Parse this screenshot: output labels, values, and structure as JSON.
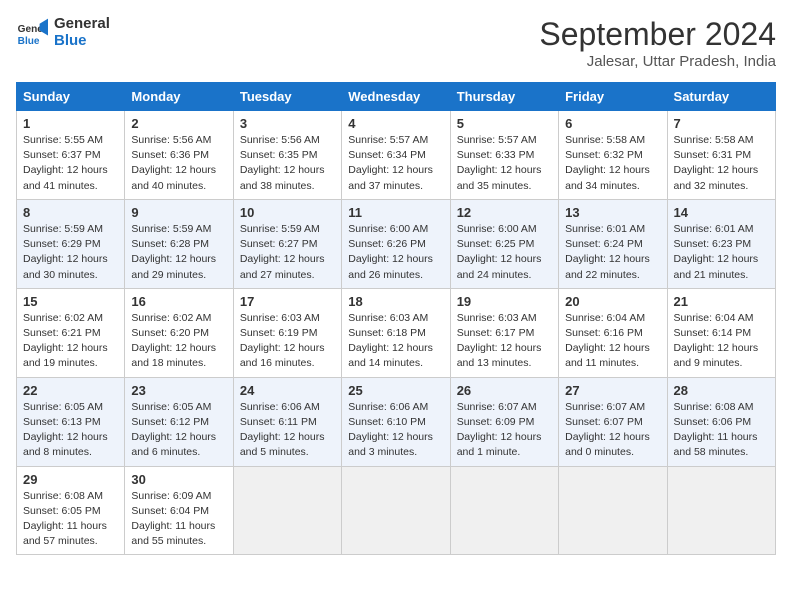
{
  "header": {
    "logo_line1": "General",
    "logo_line2": "Blue",
    "month": "September 2024",
    "location": "Jalesar, Uttar Pradesh, India"
  },
  "days_of_week": [
    "Sunday",
    "Monday",
    "Tuesday",
    "Wednesday",
    "Thursday",
    "Friday",
    "Saturday"
  ],
  "weeks": [
    [
      {
        "day": "1",
        "sunrise": "Sunrise: 5:55 AM",
        "sunset": "Sunset: 6:37 PM",
        "daylight": "Daylight: 12 hours and 41 minutes."
      },
      {
        "day": "2",
        "sunrise": "Sunrise: 5:56 AM",
        "sunset": "Sunset: 6:36 PM",
        "daylight": "Daylight: 12 hours and 40 minutes."
      },
      {
        "day": "3",
        "sunrise": "Sunrise: 5:56 AM",
        "sunset": "Sunset: 6:35 PM",
        "daylight": "Daylight: 12 hours and 38 minutes."
      },
      {
        "day": "4",
        "sunrise": "Sunrise: 5:57 AM",
        "sunset": "Sunset: 6:34 PM",
        "daylight": "Daylight: 12 hours and 37 minutes."
      },
      {
        "day": "5",
        "sunrise": "Sunrise: 5:57 AM",
        "sunset": "Sunset: 6:33 PM",
        "daylight": "Daylight: 12 hours and 35 minutes."
      },
      {
        "day": "6",
        "sunrise": "Sunrise: 5:58 AM",
        "sunset": "Sunset: 6:32 PM",
        "daylight": "Daylight: 12 hours and 34 minutes."
      },
      {
        "day": "7",
        "sunrise": "Sunrise: 5:58 AM",
        "sunset": "Sunset: 6:31 PM",
        "daylight": "Daylight: 12 hours and 32 minutes."
      }
    ],
    [
      {
        "day": "8",
        "sunrise": "Sunrise: 5:59 AM",
        "sunset": "Sunset: 6:29 PM",
        "daylight": "Daylight: 12 hours and 30 minutes."
      },
      {
        "day": "9",
        "sunrise": "Sunrise: 5:59 AM",
        "sunset": "Sunset: 6:28 PM",
        "daylight": "Daylight: 12 hours and 29 minutes."
      },
      {
        "day": "10",
        "sunrise": "Sunrise: 5:59 AM",
        "sunset": "Sunset: 6:27 PM",
        "daylight": "Daylight: 12 hours and 27 minutes."
      },
      {
        "day": "11",
        "sunrise": "Sunrise: 6:00 AM",
        "sunset": "Sunset: 6:26 PM",
        "daylight": "Daylight: 12 hours and 26 minutes."
      },
      {
        "day": "12",
        "sunrise": "Sunrise: 6:00 AM",
        "sunset": "Sunset: 6:25 PM",
        "daylight": "Daylight: 12 hours and 24 minutes."
      },
      {
        "day": "13",
        "sunrise": "Sunrise: 6:01 AM",
        "sunset": "Sunset: 6:24 PM",
        "daylight": "Daylight: 12 hours and 22 minutes."
      },
      {
        "day": "14",
        "sunrise": "Sunrise: 6:01 AM",
        "sunset": "Sunset: 6:23 PM",
        "daylight": "Daylight: 12 hours and 21 minutes."
      }
    ],
    [
      {
        "day": "15",
        "sunrise": "Sunrise: 6:02 AM",
        "sunset": "Sunset: 6:21 PM",
        "daylight": "Daylight: 12 hours and 19 minutes."
      },
      {
        "day": "16",
        "sunrise": "Sunrise: 6:02 AM",
        "sunset": "Sunset: 6:20 PM",
        "daylight": "Daylight: 12 hours and 18 minutes."
      },
      {
        "day": "17",
        "sunrise": "Sunrise: 6:03 AM",
        "sunset": "Sunset: 6:19 PM",
        "daylight": "Daylight: 12 hours and 16 minutes."
      },
      {
        "day": "18",
        "sunrise": "Sunrise: 6:03 AM",
        "sunset": "Sunset: 6:18 PM",
        "daylight": "Daylight: 12 hours and 14 minutes."
      },
      {
        "day": "19",
        "sunrise": "Sunrise: 6:03 AM",
        "sunset": "Sunset: 6:17 PM",
        "daylight": "Daylight: 12 hours and 13 minutes."
      },
      {
        "day": "20",
        "sunrise": "Sunrise: 6:04 AM",
        "sunset": "Sunset: 6:16 PM",
        "daylight": "Daylight: 12 hours and 11 minutes."
      },
      {
        "day": "21",
        "sunrise": "Sunrise: 6:04 AM",
        "sunset": "Sunset: 6:14 PM",
        "daylight": "Daylight: 12 hours and 9 minutes."
      }
    ],
    [
      {
        "day": "22",
        "sunrise": "Sunrise: 6:05 AM",
        "sunset": "Sunset: 6:13 PM",
        "daylight": "Daylight: 12 hours and 8 minutes."
      },
      {
        "day": "23",
        "sunrise": "Sunrise: 6:05 AM",
        "sunset": "Sunset: 6:12 PM",
        "daylight": "Daylight: 12 hours and 6 minutes."
      },
      {
        "day": "24",
        "sunrise": "Sunrise: 6:06 AM",
        "sunset": "Sunset: 6:11 PM",
        "daylight": "Daylight: 12 hours and 5 minutes."
      },
      {
        "day": "25",
        "sunrise": "Sunrise: 6:06 AM",
        "sunset": "Sunset: 6:10 PM",
        "daylight": "Daylight: 12 hours and 3 minutes."
      },
      {
        "day": "26",
        "sunrise": "Sunrise: 6:07 AM",
        "sunset": "Sunset: 6:09 PM",
        "daylight": "Daylight: 12 hours and 1 minute."
      },
      {
        "day": "27",
        "sunrise": "Sunrise: 6:07 AM",
        "sunset": "Sunset: 6:07 PM",
        "daylight": "Daylight: 12 hours and 0 minutes."
      },
      {
        "day": "28",
        "sunrise": "Sunrise: 6:08 AM",
        "sunset": "Sunset: 6:06 PM",
        "daylight": "Daylight: 11 hours and 58 minutes."
      }
    ],
    [
      {
        "day": "29",
        "sunrise": "Sunrise: 6:08 AM",
        "sunset": "Sunset: 6:05 PM",
        "daylight": "Daylight: 11 hours and 57 minutes."
      },
      {
        "day": "30",
        "sunrise": "Sunrise: 6:09 AM",
        "sunset": "Sunset: 6:04 PM",
        "daylight": "Daylight: 11 hours and 55 minutes."
      },
      null,
      null,
      null,
      null,
      null
    ]
  ]
}
